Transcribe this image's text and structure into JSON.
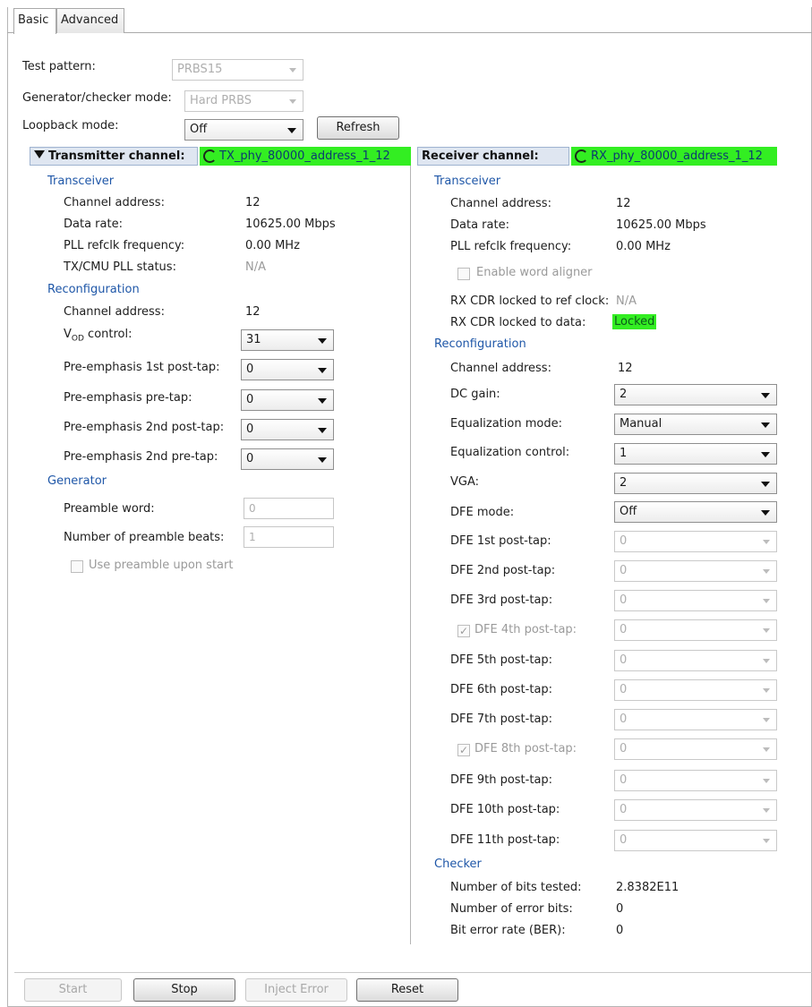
{
  "tabs": [
    {
      "label": "Basic",
      "active": true
    },
    {
      "label": "Advanced",
      "active": false
    }
  ],
  "top": {
    "test_pattern": {
      "label": "Test pattern:",
      "value": "PRBS15"
    },
    "gen_checker_mode": {
      "label": "Generator/checker mode:",
      "value": "Hard PRBS"
    },
    "loopback_mode": {
      "label": "Loopback mode:",
      "value": "Off"
    },
    "refresh_label": "Refresh"
  },
  "tx": {
    "header": "Transmitter channel:",
    "channel_name": "TX_phy_80000_address_1_12",
    "transceiver": {
      "title": "Transceiver",
      "channel_address": {
        "label": "Channel address:",
        "value": "12"
      },
      "data_rate": {
        "label": "Data rate:",
        "value": "10625.00 Mbps"
      },
      "pll_refclk": {
        "label": "PLL refclk frequency:",
        "value": "0.00 MHz"
      },
      "cmu_pll_status": {
        "label": "TX/CMU PLL status:",
        "value": "N/A"
      }
    },
    "reconfig": {
      "title": "Reconfiguration",
      "channel_address": {
        "label": "Channel address:",
        "value": "12"
      },
      "vod": {
        "label_v": "V",
        "label_sub": "OD",
        "label_rest": " control:",
        "value": "31"
      },
      "pre_emph_1st_post": {
        "label": "Pre-emphasis 1st post-tap:",
        "value": "0"
      },
      "pre_emph_pre": {
        "label": "Pre-emphasis pre-tap:",
        "value": "0"
      },
      "pre_emph_2nd_post": {
        "label": "Pre-emphasis 2nd post-tap:",
        "value": "0"
      },
      "pre_emph_2nd_pre": {
        "label": "Pre-emphasis 2nd pre-tap:",
        "value": "0"
      }
    },
    "generator": {
      "title": "Generator",
      "preamble_word": {
        "label": "Preamble word:",
        "value": "0"
      },
      "preamble_beats": {
        "label": "Number of preamble beats:",
        "value": "1"
      },
      "use_preamble": {
        "label": "Use preamble upon start",
        "checked": false
      }
    }
  },
  "rx": {
    "header": "Receiver channel:",
    "channel_name": "RX_phy_80000_address_1_12",
    "transceiver": {
      "title": "Transceiver",
      "channel_address": {
        "label": "Channel address:",
        "value": "12"
      },
      "data_rate": {
        "label": "Data rate:",
        "value": "10625.00 Mbps"
      },
      "pll_refclk": {
        "label": "PLL refclk frequency:",
        "value": "0.00 MHz"
      },
      "word_aligner": {
        "label": "Enable word aligner",
        "checked": false
      },
      "cdr_ref": {
        "label": "RX CDR locked to ref clock:",
        "value": "N/A"
      },
      "cdr_data": {
        "label": "RX CDR locked to data:",
        "value": "Locked"
      }
    },
    "reconfig": {
      "title": "Reconfiguration",
      "channel_address": {
        "label": "Channel address:",
        "value": "12"
      },
      "dc_gain": {
        "label": "DC gain:",
        "value": "2"
      },
      "eq_mode": {
        "label": "Equalization mode:",
        "value": "Manual"
      },
      "eq_control": {
        "label": "Equalization control:",
        "value": "1"
      },
      "vga": {
        "label": "VGA:",
        "value": "2"
      },
      "dfe_mode": {
        "label": "DFE mode:",
        "value": "Off"
      },
      "dfe_taps": [
        {
          "label": "DFE 1st post-tap:",
          "value": "0",
          "checkbox": false
        },
        {
          "label": "DFE 2nd post-tap:",
          "value": "0",
          "checkbox": false
        },
        {
          "label": "DFE 3rd post-tap:",
          "value": "0",
          "checkbox": false
        },
        {
          "label": "DFE 4th post-tap:",
          "value": "0",
          "checkbox": true
        },
        {
          "label": "DFE 5th post-tap:",
          "value": "0",
          "checkbox": false
        },
        {
          "label": "DFE 6th post-tap:",
          "value": "0",
          "checkbox": false
        },
        {
          "label": "DFE 7th post-tap:",
          "value": "0",
          "checkbox": false
        },
        {
          "label": "DFE 8th post-tap:",
          "value": "0",
          "checkbox": true
        },
        {
          "label": "DFE 9th post-tap:",
          "value": "0",
          "checkbox": false
        },
        {
          "label": "DFE 10th post-tap:",
          "value": "0",
          "checkbox": false
        },
        {
          "label": "DFE 11th post-tap:",
          "value": "0",
          "checkbox": false
        }
      ]
    },
    "checker": {
      "title": "Checker",
      "bits_tested": {
        "label": "Number of bits tested:",
        "value": "2.8382E11"
      },
      "error_bits": {
        "label": "Number of error bits:",
        "value": "0"
      },
      "ber": {
        "label": "Bit error rate (BER):",
        "value": "0"
      }
    }
  },
  "buttons": {
    "start": "Start",
    "stop": "Stop",
    "inject_error": "Inject Error",
    "reset": "Reset"
  },
  "colors": {
    "section_title": "#1f57a8",
    "status_green": "#33ee22",
    "header_bar": "#dfe6f1"
  }
}
